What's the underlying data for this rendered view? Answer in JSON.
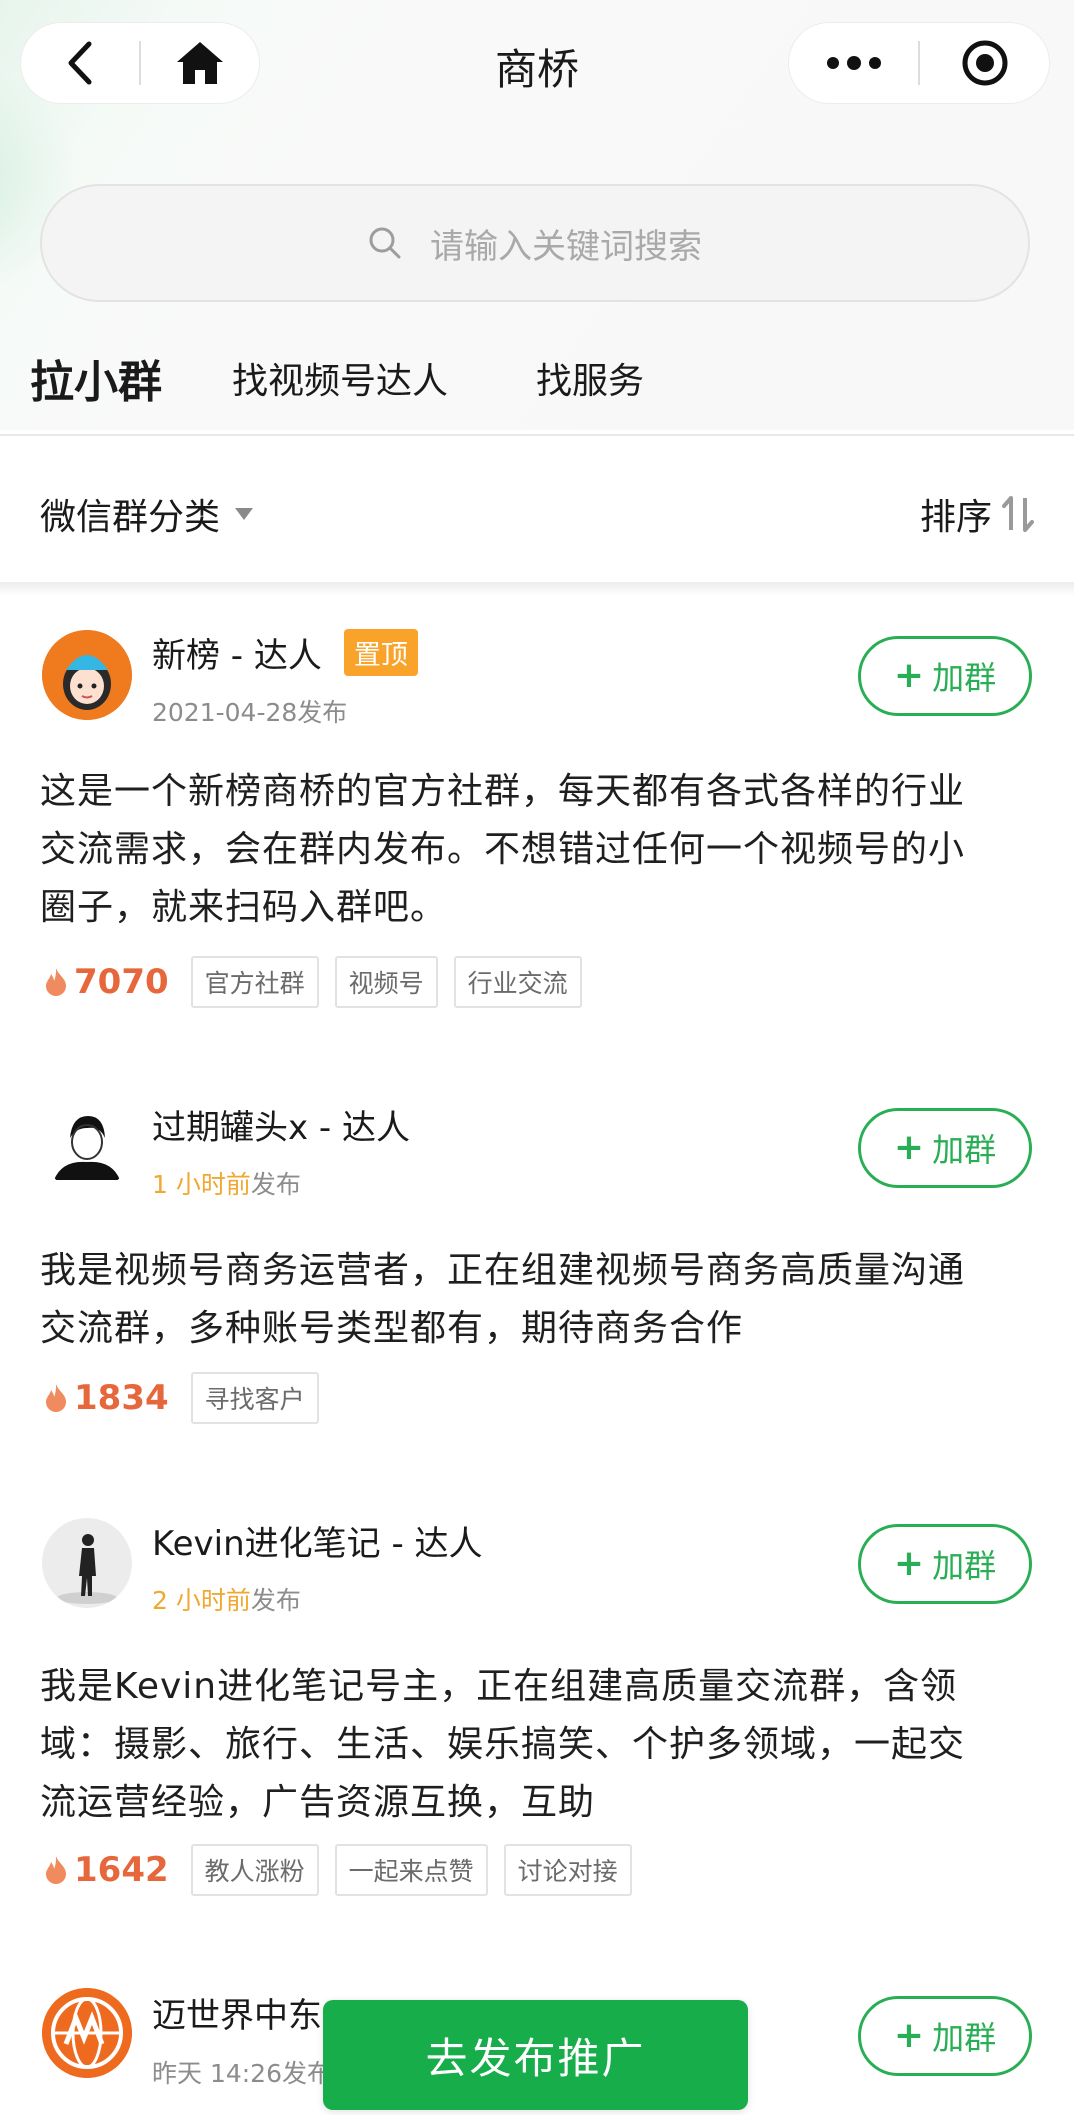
{
  "nav": {
    "title": "商桥",
    "left_icons": [
      "back-arrow-icon",
      "home-icon"
    ],
    "right_icons": [
      "more-icon",
      "target-icon"
    ]
  },
  "search": {
    "placeholder": "请输入关键词搜索"
  },
  "tabs": [
    {
      "label": "拉小群",
      "active": true
    },
    {
      "label": "找视频号达人",
      "active": false
    },
    {
      "label": "找服务",
      "active": false
    }
  ],
  "filter": {
    "category_label": "微信群分类",
    "sort_label": "排序"
  },
  "posts": [
    {
      "author": "新榜 - 达人",
      "badge": "置顶",
      "time": "2021-04-28",
      "suffix": "发布",
      "join_label": "加群",
      "lines": [
        "这是一个新榜商桥的官方社群，每天都有各式各样的行业",
        "交流需求，会在群内发布。不想错过任何一个视频号的小",
        "圈子，就来扫码入群吧。"
      ],
      "hot": "7070",
      "tags": [
        "官方社群",
        "视频号",
        "行业交流"
      ]
    },
    {
      "author": "过期罐头x - 达人",
      "time": "1 小时前",
      "suffix": "发布",
      "join_label": "加群",
      "lines": [
        "我是视频号商务运营者，正在组建视频号商务高质量沟通",
        "交流群，多种账号类型都有，期待商务合作"
      ],
      "hot": "1834",
      "tags": [
        "寻找客户"
      ]
    },
    {
      "author": "Kevin进化笔记 - 达人",
      "time": "2 小时前",
      "suffix": "发布",
      "join_label": "加群",
      "lines": [
        "我是Kevin进化笔记号主，正在组建高质量交流群，含领",
        "域：摄影、旅行、生活、娱乐搞笑、个护多领域，一起交",
        "流运营经验，广告资源互换，互助"
      ],
      "hot": "1642",
      "tags": [
        "教人涨粉",
        "一起来点赞",
        "讨论对接"
      ]
    },
    {
      "author": "迈世界中东",
      "time": "昨天 14:26",
      "suffix": "发布",
      "join_label": "加群"
    }
  ],
  "publish_button": "去发布推广",
  "colors": {
    "accent": "#17ad4a",
    "pin": "#f9a32a",
    "hot": "#e7673c",
    "recent": "#f0a830"
  }
}
